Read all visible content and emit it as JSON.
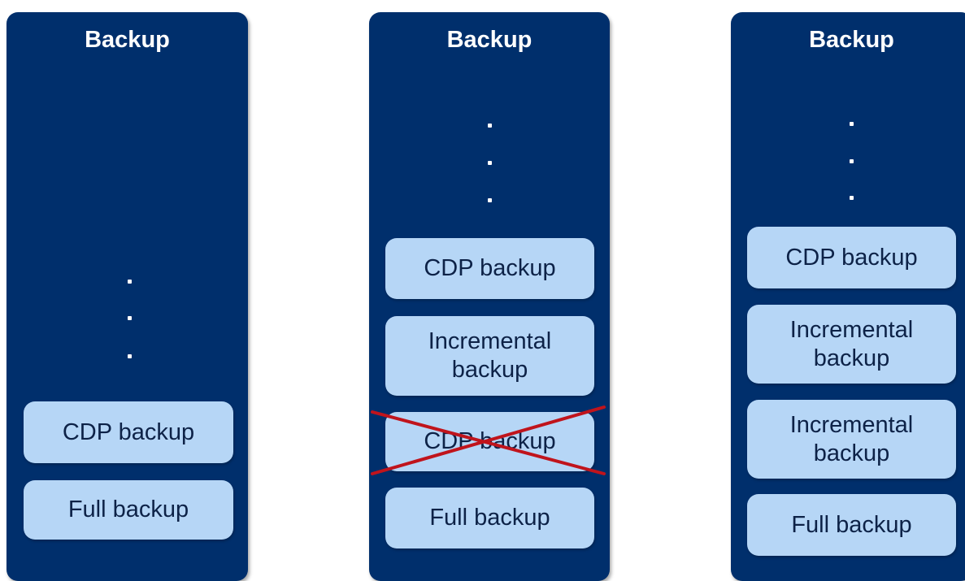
{
  "columns": [
    {
      "title": "Backup",
      "boxes": [
        {
          "label": "CDP backup",
          "removed": false
        },
        {
          "label": "Full backup",
          "removed": false
        }
      ]
    },
    {
      "title": "Backup",
      "boxes": [
        {
          "label": "CDP backup",
          "removed": false
        },
        {
          "label": "Incremental backup",
          "removed": false
        },
        {
          "label": "CDP backup",
          "removed": true
        },
        {
          "label": "Full backup",
          "removed": false
        }
      ]
    },
    {
      "title": "Backup",
      "boxes": [
        {
          "label": "CDP backup",
          "removed": false
        },
        {
          "label": "Incremental backup",
          "removed": false
        },
        {
          "label": "Incremental backup",
          "removed": false
        },
        {
          "label": "Full backup",
          "removed": false
        }
      ]
    }
  ],
  "colors": {
    "panel": "#002f6c",
    "box": "#b6d6f6",
    "box_text": "#0d2247",
    "strike": "#c0141c"
  }
}
